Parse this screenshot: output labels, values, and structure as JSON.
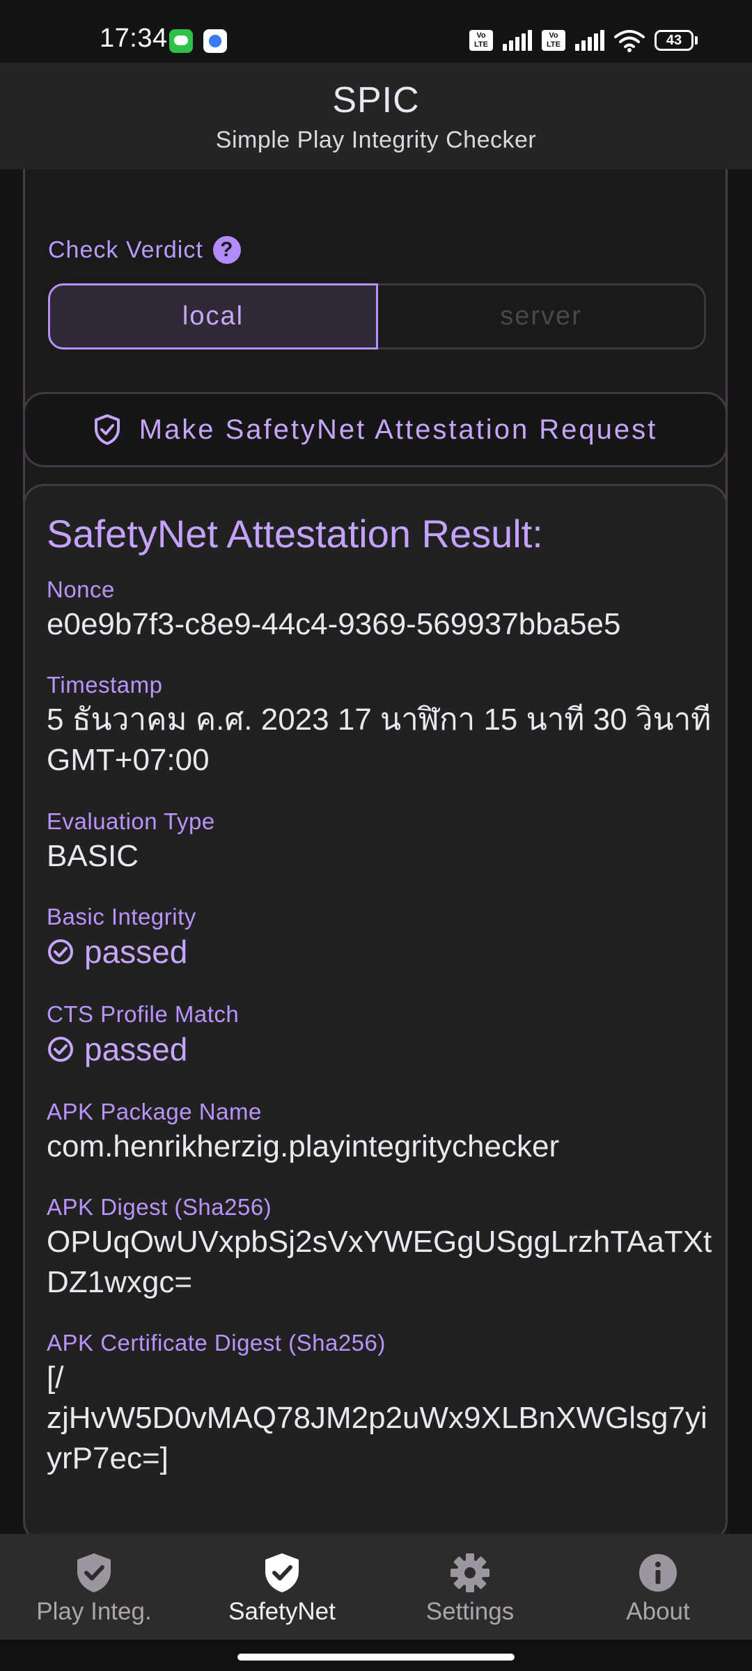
{
  "status_bar": {
    "time": "17:34",
    "notification_icons": [
      "line-app-icon",
      "settings-app-icon"
    ],
    "volte1": "Vo LTE",
    "volte2": "Vo LTE",
    "battery": "43"
  },
  "app_bar": {
    "title": "SPIC",
    "subtitle": "Simple Play Integrity Checker"
  },
  "options_card": {
    "first_toggle": {
      "left": "local",
      "right": "server",
      "selected": "local"
    },
    "check_verdict_label": "Check Verdict",
    "help_icon": "?",
    "verdict_toggle": {
      "left": "local",
      "right": "server",
      "selected": "local"
    }
  },
  "request_button": {
    "label": "Make SafetyNet Attestation Request",
    "icon": "shield-check-icon"
  },
  "result": {
    "title": "SafetyNet Attestation Result:",
    "fields": [
      {
        "label": "Nonce",
        "value": "e0e9b7f3-c8e9-44c4-9369-569937bba5e5"
      },
      {
        "label": "Timestamp",
        "value": "5 ธันวาคม ค.ศ. 2023 17 นาฬิกา 15 นาที 30 วินาที GMT+07:00"
      },
      {
        "label": "Evaluation Type",
        "value": "BASIC"
      },
      {
        "label": "Basic Integrity",
        "value": "passed"
      },
      {
        "label": "CTS Profile Match",
        "value": "passed"
      },
      {
        "label": "APK Package Name",
        "value": "com.henrikherzig.playintegritychecker"
      },
      {
        "label": "APK Digest (Sha256)",
        "value": "OPUqOwUVxpbSj2sVxYWEGgUSggLrzhTAaTXtDZ1wxgc="
      },
      {
        "label": "APK Certificate Digest (Sha256)",
        "value": "[/\nzjHvW5D0vMAQ78JM2p2uWx9XLBnXWGlsg7yiyrP7ec=]"
      }
    ]
  },
  "bottom_nav": {
    "items": [
      {
        "label": "Play Integ.",
        "icon": "shield-check-outline-icon",
        "active": false
      },
      {
        "label": "SafetyNet",
        "icon": "shield-check-icon",
        "active": true
      },
      {
        "label": "Settings",
        "icon": "gear-icon",
        "active": false
      },
      {
        "label": "About",
        "icon": "info-icon",
        "active": false
      }
    ]
  },
  "colors": {
    "accent": "#c4a2ff",
    "background": "#141414",
    "card": "#212121",
    "app_bar": "#252526",
    "bottom_nav": "#2c2c2c"
  }
}
